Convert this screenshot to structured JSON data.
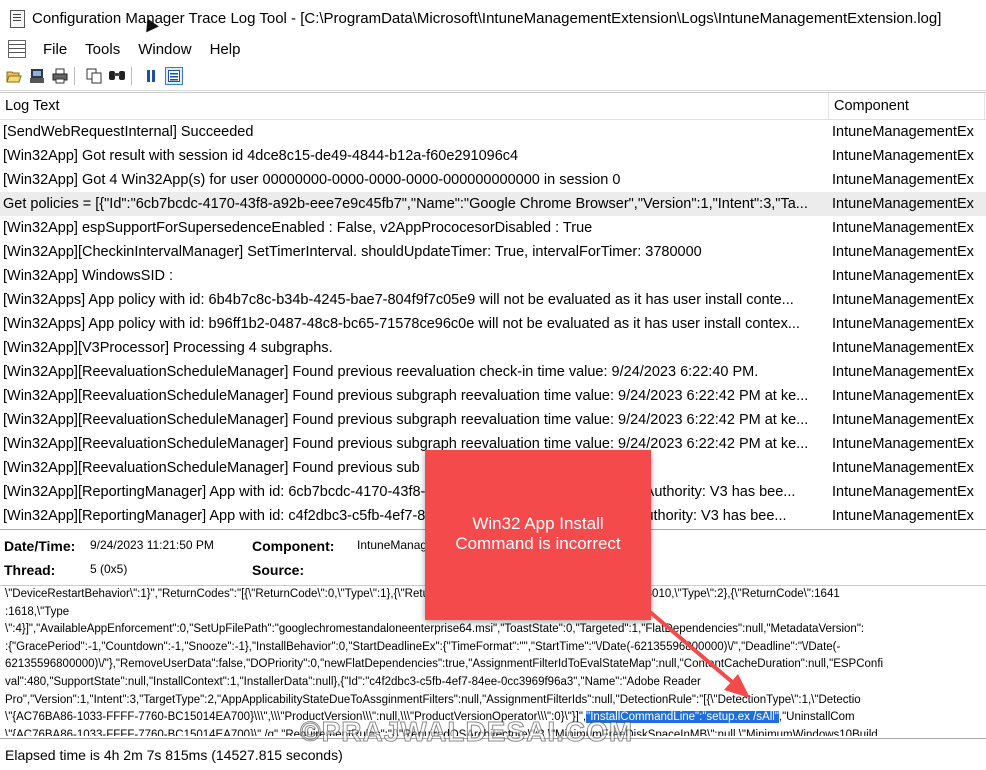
{
  "window": {
    "title": "Configuration Manager Trace Log Tool - [C:\\ProgramData\\Microsoft\\IntuneManagementExtension\\Logs\\IntuneManagementExtension.log]"
  },
  "menu": {
    "items": [
      "File",
      "Tools",
      "Window",
      "Help"
    ]
  },
  "toolbar": {
    "buttons": [
      "open-icon",
      "print-preview-icon",
      "print-icon",
      "copy-icon",
      "find-icon",
      "pause-icon",
      "details-pane-icon"
    ]
  },
  "grid": {
    "columns": [
      "Log Text",
      "Component"
    ],
    "rows": [
      {
        "text": "[SendWebRequestInternal] Succeeded",
        "component": "IntuneManagementEx"
      },
      {
        "text": "[Win32App] Got result with session id 4dce8c15-de49-4844-b12a-f60e291096c4",
        "component": "IntuneManagementEx"
      },
      {
        "text": "[Win32App] Got 4 Win32App(s) for user 00000000-0000-0000-0000-000000000000 in session 0",
        "component": "IntuneManagementEx"
      },
      {
        "text": "Get policies = [{\"Id\":\"6cb7bcdc-4170-43f8-a92b-eee7e9c45fb7\",\"Name\":\"Google Chrome Browser\",\"Version\":1,\"Intent\":3,\"Ta...",
        "component": "IntuneManagementEx",
        "selected": true
      },
      {
        "text": "[Win32App] espSupportForSupersedenceEnabled : False, v2AppPrococesorDisabled : True",
        "component": "IntuneManagementEx"
      },
      {
        "text": "[Win32App][CheckinIntervalManager] SetTimerInterval. shouldUpdateTimer: True, intervalForTimer: 3780000",
        "component": "IntuneManagementEx"
      },
      {
        "text": "[Win32App] WindowsSID :",
        "component": "IntuneManagementEx"
      },
      {
        "text": "[Win32Apps] App policy with id: 6b4b7c8c-b34b-4245-bae7-804f9f7c05e9 will not be evaluated as it has user install conte...",
        "component": "IntuneManagementEx"
      },
      {
        "text": "[Win32Apps] App policy with id: b96ff1b2-0487-48c8-bc65-71578ce96c0e will not be evaluated as it has user install contex...",
        "component": "IntuneManagementEx"
      },
      {
        "text": "[Win32App][V3Processor] Processing 4 subgraphs.",
        "component": "IntuneManagementEx"
      },
      {
        "text": "[Win32App][ReevaluationScheduleManager] Found previous reevaluation check-in time value: 9/24/2023 6:22:40 PM.",
        "component": "IntuneManagementEx"
      },
      {
        "text": "[Win32App][ReevaluationScheduleManager] Found previous subgraph reevaluation time value: 9/24/2023 6:22:42 PM at ke...",
        "component": "IntuneManagementEx"
      },
      {
        "text": "[Win32App][ReevaluationScheduleManager] Found previous subgraph reevaluation time value: 9/24/2023 6:22:42 PM at ke...",
        "component": "IntuneManagementEx"
      },
      {
        "text": "[Win32App][ReevaluationScheduleManager] Found previous subgraph reevaluation time value: 9/24/2023 6:22:42 PM at ke...",
        "component": "IntuneManagementEx"
      },
      {
        "text": "[Win32App][ReevaluationScheduleManager] Found previous sub",
        "component": "IntuneManagementEx"
      },
      {
        "text": "[Win32App][ReportingManager] App with id: 6cb7bcdc-4170-43f8-a92b-eee7e9c45fb7 and prior AppAuthority: V3 has bee...",
        "component": "IntuneManagementEx"
      },
      {
        "text": "[Win32App][ReportingManager] App with id: c4f2dbc3-c5fb-4ef7-84ee-0cc3969f96a3 and prior AppAuthority: V3 has bee...",
        "component": "IntuneManagementEx"
      }
    ]
  },
  "details": {
    "datetime_label": "Date/Time:",
    "datetime_value": "9/24/2023 11:21:50 PM",
    "component_label": "Component:",
    "component_value": "IntuneManagementExtension",
    "thread_label": "Thread:",
    "thread_value": "5 (0x5)",
    "source_label": "Source:",
    "source_value": ""
  },
  "detail_text": {
    "lines": [
      "\\\"DeviceRestartBehavior\\\":1}\",\"ReturnCodes\":\"[{\\\"ReturnCode\\\":0,\\\"Type\\\":1},{\\\"ReturnCode\\\":1707,\\\"Type\\\":1},{\\\"ReturnCode\\\":3010,\\\"Type\\\":2},{\\\"ReturnCode\\\":1641",
      ":1618,\\\"Type",
      "\\\":4}]\",\"AvailableAppEnforcement\":0,\"SetUpFilePath\":\"googlechromestandaloneenterprise64.msi\",\"ToastState\":0,\"Targeted\":1,\"FlatDependencies\":null,\"MetadataVersion\":",
      ":{\"GracePeriod\":-1,\"Countdown\":-1,\"Snooze\":-1},\"InstallBehavior\":0,\"StartDeadlineEx\":{\"TimeFormat\":\"\",\"StartTime\":\"\\/Date(-62135596800000)\\/\",\"Deadline\":\"\\/Date(-",
      "62135596800000)\\/\"},\"RemoveUserData\":false,\"DOPriority\":0,\"newFlatDependencies\":true,\"AssignmentFilterIdToEvalStateMap\":null,\"ContentCacheDuration\":null,\"ESPConfi",
      "val\":480,\"SupportState\":null,\"InstallContext\":1,\"InstallerData\":null},{\"Id\":\"c4f2dbc3-c5fb-4ef7-84ee-0cc3969f96a3\",\"Name\":\"Adobe Reader",
      "Pro\",\"Version\":1,\"Intent\":3,\"TargetType\":2,\"AppApplicabilityStateDueToAssginmentFilters\":null,\"AssignmentFilterIds\":null,\"DetectionRule\":\"[{\\\"DetectionType\\\":1,\\\"Detectio",
      "\\\"{AC76BA86-1033-FFFF-7760-BC15014EA700}\\\\\\\",\\\\\\\"ProductVersion\\\\\\\":null,\\\\\\\"ProductVersionOperator\\\\\\\":0}\\\"}]\",",
      "\\\"{AC76BA86-1033-FFFF-7760-BC15014EA700}\\\" /q\",\"RequirementRules\":\"{\\\"RequiredOSArchitecture\\\":3,\\\"MinimumFreeDiskSpaceInMB\\\":null,\\\"MinimumWindows10Build"
    ],
    "highlight": "\"InstallCommandLine\":\"setup.ex /sAll\"",
    "highlight_tail": ",\"UninstallCom"
  },
  "status": {
    "text": "Elapsed time is 4h 2m 7s 815ms (14527.815 seconds)"
  },
  "callout": {
    "line1": "Win32 App Install",
    "line2": "Command is incorrect"
  },
  "watermark": "©PRAJWALDESAI.COM",
  "colors": {
    "callout": "#f44a4b",
    "highlight": "#1e6fd9",
    "selected_row": "#ececec"
  }
}
